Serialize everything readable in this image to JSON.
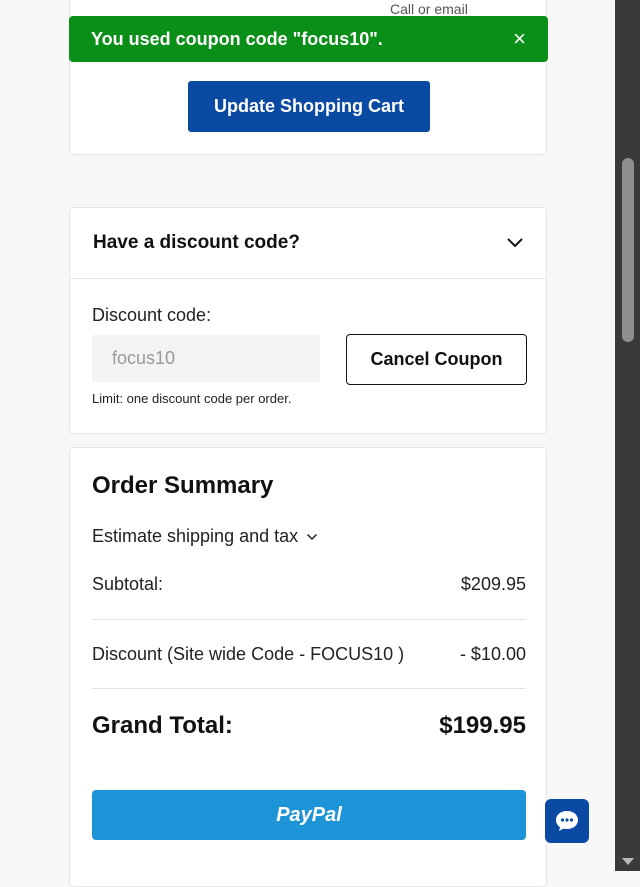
{
  "cart": {
    "cutoff_text": "Call or email",
    "update_button": "Update Shopping Cart"
  },
  "notice": {
    "message": "You used coupon code \"focus10\".",
    "close_glyph": "×",
    "color": "#0a9018"
  },
  "discount": {
    "title": "Have a discount code?",
    "label": "Discount code:",
    "input_value": "focus10",
    "cancel_button": "Cancel Coupon",
    "limit_text": "Limit: one discount code per order."
  },
  "summary": {
    "title": "Order Summary",
    "estimate_label": "Estimate shipping and tax",
    "subtotal_label": "Subtotal:",
    "subtotal_value": "$209.95",
    "discount_label": "Discount (Site wide Code - FOCUS10 )",
    "discount_value": "- $10.00",
    "grand_label": "Grand Total:",
    "grand_value": "$199.95",
    "paypal_label": "PayPal"
  },
  "colors": {
    "primary": "#0b4aa2",
    "paypal": "#1e94d8"
  },
  "icons": {
    "notice_close": "close-icon",
    "discount_toggle": "chevron-down-icon",
    "estimate_toggle": "chevron-down-icon",
    "chat": "chat-bubble-icon"
  }
}
